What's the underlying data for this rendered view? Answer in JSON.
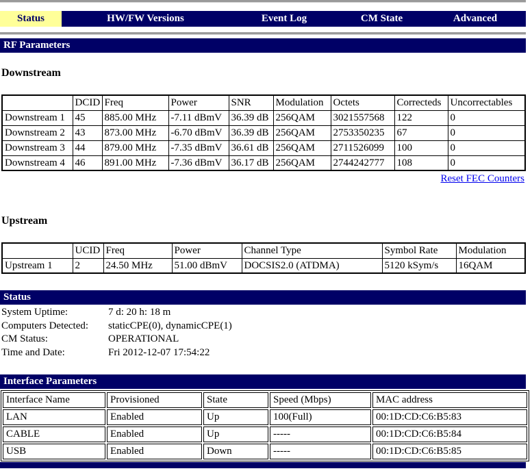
{
  "colors": {
    "navy": "#000066",
    "active_tab_bg": "#ffff99",
    "link_blue": "#0000ee",
    "rule_gray": "#9a9a9a"
  },
  "nav": {
    "tabs": [
      {
        "label": "Status",
        "active": true
      },
      {
        "label": "HW/FW Versions",
        "active": false
      },
      {
        "label": "Event Log",
        "active": false
      },
      {
        "label": "CM State",
        "active": false
      },
      {
        "label": "Advanced",
        "active": false
      }
    ]
  },
  "rf": {
    "section_title": "RF Parameters",
    "downstream": {
      "label": "Downstream",
      "headers": [
        "",
        "DCID",
        "Freq",
        "Power",
        "SNR",
        "Modulation",
        "Octets",
        "Correcteds",
        "Uncorrectables"
      ],
      "rows": [
        [
          "Downstream 1",
          "45",
          "885.00 MHz",
          "-7.11 dBmV",
          "36.39 dB",
          "256QAM",
          "3021557568",
          "122",
          "0"
        ],
        [
          "Downstream 2",
          "43",
          "873.00 MHz",
          "-6.70 dBmV",
          "36.39 dB",
          "256QAM",
          "2753350235",
          "67",
          "0"
        ],
        [
          "Downstream 3",
          "44",
          "879.00 MHz",
          "-7.35 dBmV",
          "36.61 dB",
          "256QAM",
          "2711526099",
          "100",
          "0"
        ],
        [
          "Downstream 4",
          "46",
          "891.00 MHz",
          "-7.36 dBmV",
          "36.17 dB",
          "256QAM",
          "2744242777",
          "108",
          "0"
        ]
      ],
      "reset_link_label": "Reset FEC Counters"
    },
    "upstream": {
      "label": "Upstream",
      "headers": [
        "",
        "UCID",
        "Freq",
        "Power",
        "Channel Type",
        "Symbol Rate",
        "Modulation"
      ],
      "rows": [
        [
          "Upstream 1",
          "2",
          "24.50 MHz",
          "51.00 dBmV",
          "DOCSIS2.0 (ATDMA)",
          "5120 kSym/s",
          "16QAM"
        ]
      ]
    }
  },
  "status": {
    "section_title": "Status",
    "fields": [
      {
        "label": "System Uptime:",
        "value": "7 d: 20 h: 18 m"
      },
      {
        "label": "Computers Detected:",
        "value": "staticCPE(0), dynamicCPE(1)"
      },
      {
        "label": "CM Status:",
        "value": "OPERATIONAL"
      },
      {
        "label": "Time and Date:",
        "value": "Fri 2012-12-07 17:54:22"
      }
    ]
  },
  "interfaces": {
    "section_title": "Interface Parameters",
    "headers": [
      "Interface Name",
      "Provisioned",
      "State",
      "Speed (Mbps)",
      "MAC address"
    ],
    "rows": [
      [
        "LAN",
        "Enabled",
        "Up",
        "100(Full)",
        "00:1D:CD:C6:B5:83"
      ],
      [
        "CABLE",
        "Enabled",
        "Up",
        "-----",
        "00:1D:CD:C6:B5:84"
      ],
      [
        "USB",
        "Enabled",
        "Down",
        "-----",
        "00:1D:CD:C6:B5:85"
      ]
    ]
  }
}
